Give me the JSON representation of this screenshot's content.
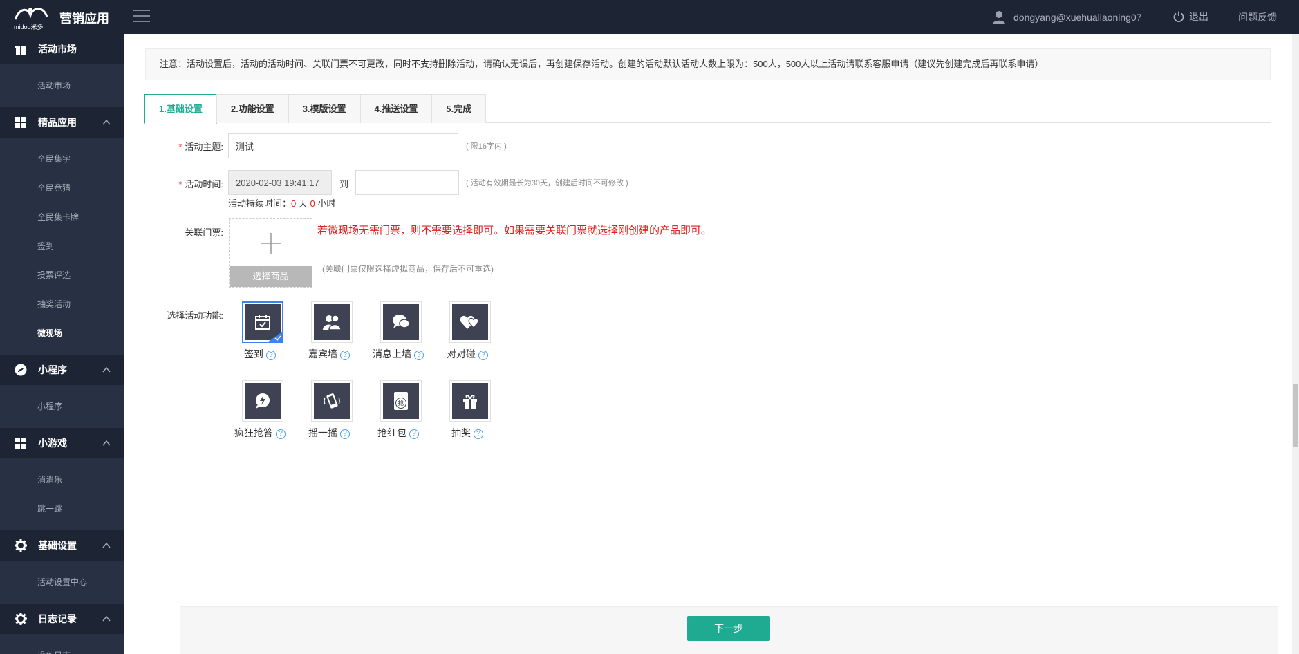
{
  "header": {
    "brand": "midoo米多",
    "app_title": "营销应用",
    "user_email": "dongyang@xuehualiaoning07",
    "logout_label": "退出",
    "feedback_label": "问题反馈"
  },
  "sidebar": {
    "groups": [
      {
        "title": "活动市场",
        "icon": "gift-icon",
        "items": [
          "活动市场"
        ]
      },
      {
        "title": "精品应用",
        "icon": "apps-icon",
        "items": [
          "全民集字",
          "全民竞猜",
          "全民集卡牌",
          "签到",
          "投票评选",
          "抽奖活动",
          "微现场"
        ]
      },
      {
        "title": "小程序",
        "icon": "miniprogram-icon",
        "items": [
          "小程序"
        ]
      },
      {
        "title": "小游戏",
        "icon": "apps-icon",
        "items": [
          "消消乐",
          "跳一跳"
        ]
      },
      {
        "title": "基础设置",
        "icon": "gear-icon",
        "items": [
          "活动设置中心"
        ]
      },
      {
        "title": "日志记录",
        "icon": "gear-icon",
        "items": [
          "操作日志"
        ]
      }
    ],
    "active_item": "微现场"
  },
  "notice": "注意：活动设置后，活动的活动时间、关联门票不可更改，同时不支持删除活动，请确认无误后，再创建保存活动。创建的活动默认活动人数上限为：500人，500人以上活动请联系客服申请（建议先创建完成后再联系申请）",
  "tabs": [
    "1.基础设置",
    "2.功能设置",
    "3.模版设置",
    "4.推送设置",
    "5.完成"
  ],
  "active_tab": "1.基础设置",
  "form": {
    "topic_label": "活动主题:",
    "topic_value": "测试",
    "topic_hint": "( 限16字内 )",
    "time_label": "活动时间:",
    "time_start": "2020-02-03 19:41:17",
    "time_to": "到",
    "time_end": "",
    "time_hint": "( 活动有效期最长为30天，创建后时间不可修改 )",
    "duration_prefix": "活动持续时间：",
    "duration_days": "0",
    "duration_day_unit": " 天 ",
    "duration_hours": "0",
    "duration_hour_unit": " 小时",
    "ticket_label": "关联门票:",
    "ticket_button": "选择商品",
    "ticket_red_note": "若微现场无需门票，则不需要选择即可。如果需要关联门票就选择刚创建的产品即可。",
    "ticket_hint": "(关联门票仅限选择虚拟商品，保存后不可重选)",
    "features_label": "选择活动功能:"
  },
  "features": [
    {
      "label": "签到",
      "icon": "calendar-check-icon",
      "selected": true
    },
    {
      "label": "嘉宾墙",
      "icon": "guests-icon",
      "selected": false
    },
    {
      "label": "消息上墙",
      "icon": "chat-bubbles-icon",
      "selected": false
    },
    {
      "label": "对对碰",
      "icon": "hearts-icon",
      "selected": false
    },
    {
      "label": "疯狂抢答",
      "icon": "lightning-bubble-icon",
      "selected": false
    },
    {
      "label": "摇一摇",
      "icon": "shake-phone-icon",
      "selected": false
    },
    {
      "label": "抢红包",
      "icon": "red-envelope-icon",
      "selected": false
    },
    {
      "label": "抽奖",
      "icon": "gift-box-icon",
      "selected": false
    }
  ],
  "red_envelope_char": "抢",
  "help_mark": "?",
  "next_button": "下一步",
  "colors": {
    "accent": "#1eab92",
    "sidebar": "#273143",
    "topbar": "#1d2535",
    "warning": "#e02020"
  }
}
